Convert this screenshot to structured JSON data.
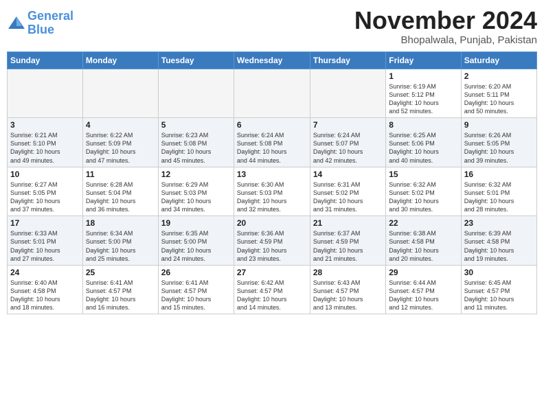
{
  "header": {
    "logo_line1": "General",
    "logo_line2": "Blue",
    "month_title": "November 2024",
    "location": "Bhopalwala, Punjab, Pakistan"
  },
  "weekdays": [
    "Sunday",
    "Monday",
    "Tuesday",
    "Wednesday",
    "Thursday",
    "Friday",
    "Saturday"
  ],
  "weeks": [
    [
      {
        "day": "",
        "info": ""
      },
      {
        "day": "",
        "info": ""
      },
      {
        "day": "",
        "info": ""
      },
      {
        "day": "",
        "info": ""
      },
      {
        "day": "",
        "info": ""
      },
      {
        "day": "1",
        "info": "Sunrise: 6:19 AM\nSunset: 5:12 PM\nDaylight: 10 hours\nand 52 minutes."
      },
      {
        "day": "2",
        "info": "Sunrise: 6:20 AM\nSunset: 5:11 PM\nDaylight: 10 hours\nand 50 minutes."
      }
    ],
    [
      {
        "day": "3",
        "info": "Sunrise: 6:21 AM\nSunset: 5:10 PM\nDaylight: 10 hours\nand 49 minutes."
      },
      {
        "day": "4",
        "info": "Sunrise: 6:22 AM\nSunset: 5:09 PM\nDaylight: 10 hours\nand 47 minutes."
      },
      {
        "day": "5",
        "info": "Sunrise: 6:23 AM\nSunset: 5:08 PM\nDaylight: 10 hours\nand 45 minutes."
      },
      {
        "day": "6",
        "info": "Sunrise: 6:24 AM\nSunset: 5:08 PM\nDaylight: 10 hours\nand 44 minutes."
      },
      {
        "day": "7",
        "info": "Sunrise: 6:24 AM\nSunset: 5:07 PM\nDaylight: 10 hours\nand 42 minutes."
      },
      {
        "day": "8",
        "info": "Sunrise: 6:25 AM\nSunset: 5:06 PM\nDaylight: 10 hours\nand 40 minutes."
      },
      {
        "day": "9",
        "info": "Sunrise: 6:26 AM\nSunset: 5:05 PM\nDaylight: 10 hours\nand 39 minutes."
      }
    ],
    [
      {
        "day": "10",
        "info": "Sunrise: 6:27 AM\nSunset: 5:05 PM\nDaylight: 10 hours\nand 37 minutes."
      },
      {
        "day": "11",
        "info": "Sunrise: 6:28 AM\nSunset: 5:04 PM\nDaylight: 10 hours\nand 36 minutes."
      },
      {
        "day": "12",
        "info": "Sunrise: 6:29 AM\nSunset: 5:03 PM\nDaylight: 10 hours\nand 34 minutes."
      },
      {
        "day": "13",
        "info": "Sunrise: 6:30 AM\nSunset: 5:03 PM\nDaylight: 10 hours\nand 32 minutes."
      },
      {
        "day": "14",
        "info": "Sunrise: 6:31 AM\nSunset: 5:02 PM\nDaylight: 10 hours\nand 31 minutes."
      },
      {
        "day": "15",
        "info": "Sunrise: 6:32 AM\nSunset: 5:02 PM\nDaylight: 10 hours\nand 30 minutes."
      },
      {
        "day": "16",
        "info": "Sunrise: 6:32 AM\nSunset: 5:01 PM\nDaylight: 10 hours\nand 28 minutes."
      }
    ],
    [
      {
        "day": "17",
        "info": "Sunrise: 6:33 AM\nSunset: 5:01 PM\nDaylight: 10 hours\nand 27 minutes."
      },
      {
        "day": "18",
        "info": "Sunrise: 6:34 AM\nSunset: 5:00 PM\nDaylight: 10 hours\nand 25 minutes."
      },
      {
        "day": "19",
        "info": "Sunrise: 6:35 AM\nSunset: 5:00 PM\nDaylight: 10 hours\nand 24 minutes."
      },
      {
        "day": "20",
        "info": "Sunrise: 6:36 AM\nSunset: 4:59 PM\nDaylight: 10 hours\nand 23 minutes."
      },
      {
        "day": "21",
        "info": "Sunrise: 6:37 AM\nSunset: 4:59 PM\nDaylight: 10 hours\nand 21 minutes."
      },
      {
        "day": "22",
        "info": "Sunrise: 6:38 AM\nSunset: 4:58 PM\nDaylight: 10 hours\nand 20 minutes."
      },
      {
        "day": "23",
        "info": "Sunrise: 6:39 AM\nSunset: 4:58 PM\nDaylight: 10 hours\nand 19 minutes."
      }
    ],
    [
      {
        "day": "24",
        "info": "Sunrise: 6:40 AM\nSunset: 4:58 PM\nDaylight: 10 hours\nand 18 minutes."
      },
      {
        "day": "25",
        "info": "Sunrise: 6:41 AM\nSunset: 4:57 PM\nDaylight: 10 hours\nand 16 minutes."
      },
      {
        "day": "26",
        "info": "Sunrise: 6:41 AM\nSunset: 4:57 PM\nDaylight: 10 hours\nand 15 minutes."
      },
      {
        "day": "27",
        "info": "Sunrise: 6:42 AM\nSunset: 4:57 PM\nDaylight: 10 hours\nand 14 minutes."
      },
      {
        "day": "28",
        "info": "Sunrise: 6:43 AM\nSunset: 4:57 PM\nDaylight: 10 hours\nand 13 minutes."
      },
      {
        "day": "29",
        "info": "Sunrise: 6:44 AM\nSunset: 4:57 PM\nDaylight: 10 hours\nand 12 minutes."
      },
      {
        "day": "30",
        "info": "Sunrise: 6:45 AM\nSunset: 4:57 PM\nDaylight: 10 hours\nand 11 minutes."
      }
    ]
  ]
}
